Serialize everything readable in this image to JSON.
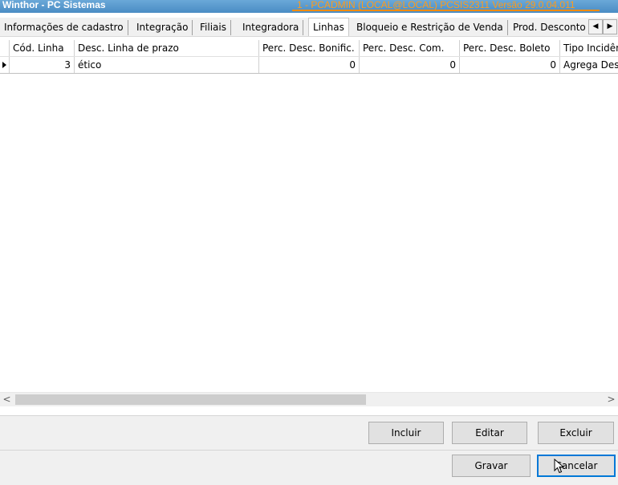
{
  "titlebar": {
    "app_title": "Winthor - PC Sistemas",
    "session_info": "1 - PCADMIN (LOCAL@LOCAL)   PCSIS2311  Versão  29.0.04.011"
  },
  "tabs": [
    {
      "label": "Informações de cadastro",
      "active": false
    },
    {
      "label": "Integração",
      "active": false
    },
    {
      "label": "Filiais",
      "active": false
    },
    {
      "label": "Integradora",
      "active": false
    },
    {
      "label": "Linhas",
      "active": true
    },
    {
      "label": "Bloqueio e Restrição de Venda",
      "active": false
    },
    {
      "label": "Prod. Desconto",
      "active": false
    }
  ],
  "tab_scroll": {
    "left": "◀",
    "right": "▶"
  },
  "grid": {
    "columns": [
      "Cód. Linha",
      "Desc. Linha de prazo",
      "Perc. Desc. Bonific.",
      "Perc. Desc. Com.",
      "Perc. Desc. Boleto",
      "Tipo Incidência"
    ],
    "rows": [
      [
        "3",
        "ético",
        "0",
        "0",
        "0",
        "Agrega Desconto"
      ]
    ]
  },
  "hscroll": {
    "left": "<",
    "right": ">"
  },
  "buttons": {
    "incluir": "Incluir",
    "editar": "Editar",
    "excluir": "Excluir",
    "gravar": "Gravar",
    "cancelar": "Cancelar"
  }
}
